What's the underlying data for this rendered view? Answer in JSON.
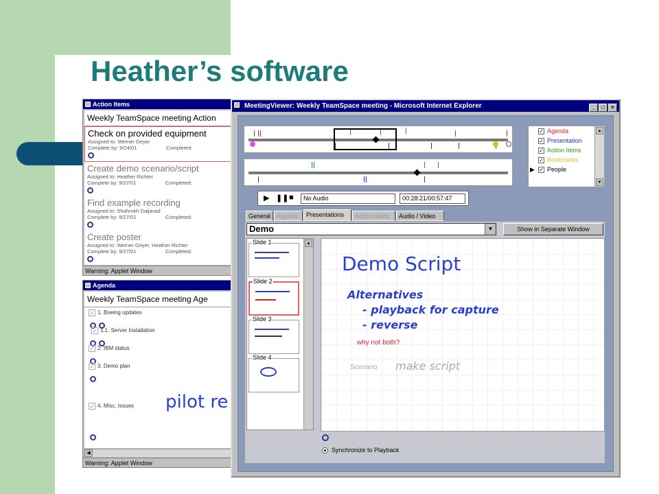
{
  "slide_title": "Heather’s software",
  "action_items_window": {
    "title": "Action Items",
    "header": "Weekly TeamSpace meeting Action",
    "items": [
      {
        "title": "Check on provided equipment",
        "assigned": "Assigned to: Werner Geyer",
        "complete_by": "Complete by: 9/24/01",
        "completed": "Completed:"
      },
      {
        "title": "Create demo scenario/script",
        "assigned": "Assigned to: Heather Richter",
        "complete_by": "Complete by: 9/27/01",
        "completed": "Completed:"
      },
      {
        "title": "Find example recording",
        "assigned": "Assigned to: Shahrokh Daijavad",
        "complete_by": "Complete by: 9/27/01",
        "completed": "Completed:"
      },
      {
        "title": "Create poster",
        "assigned": "Assigned to: Werner Geyer, Heather Richter",
        "complete_by": "Complete by: 9/27/01",
        "completed": "Completed:"
      }
    ],
    "status": "Warning: Applet Window"
  },
  "agenda_window": {
    "title": "Agenda",
    "header": "Weekly TeamSpace meeting Age",
    "items": [
      "1.  Boeing updates",
      "1.1.  Server Installation",
      "2.  IBM status",
      "3.  Demo plan",
      "4.  Misc. Issues"
    ],
    "handwriting": "pilot re",
    "status": "Warning: Applet Window"
  },
  "meeting_viewer": {
    "title": "MeetingViewer: Weekly TeamSpace meeting - Microsoft Internet Explorer",
    "legend": [
      {
        "label": "Agenda",
        "color": "#e02020",
        "checked": true
      },
      {
        "label": "Presentation",
        "color": "#2030d0",
        "checked": true
      },
      {
        "label": "Action Items",
        "color": "#20a020",
        "checked": true
      },
      {
        "label": "Bookmarks",
        "color": "#e0c020",
        "checked": true
      },
      {
        "label": "People",
        "color": "#000000",
        "checked": true
      }
    ],
    "audio_field": "No Audio",
    "time_field": "00:28:21/00:57:47",
    "tabs": [
      "General",
      "Agenda",
      "Presentations",
      "Action Items",
      "Audio / Video"
    ],
    "active_tab": "Presentations",
    "presentation_select": "Demo",
    "show_separate_button": "Show in Separate Window",
    "slides": [
      "Slide 1",
      "Slide 2",
      "Slide 3",
      "Slide 4"
    ],
    "slide_content": {
      "title": "Demo Script",
      "line1": "Alternatives",
      "line2": "- playback for capture",
      "line3": "- reverse",
      "note": "why not both?",
      "scenario_label": "Scenario",
      "scenario_hw": "make script"
    },
    "sync_label": "Synchronize to Playback"
  }
}
